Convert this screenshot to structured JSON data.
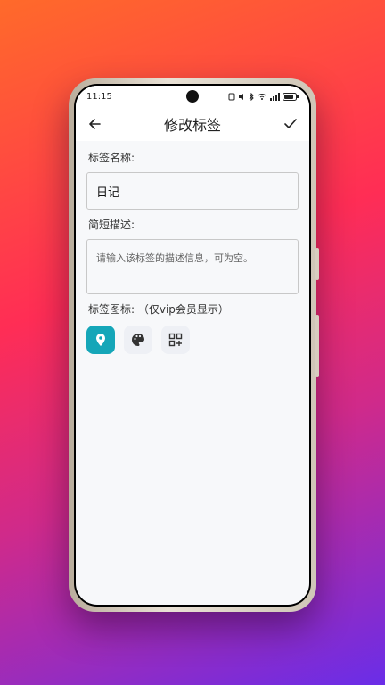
{
  "status": {
    "time": "11:15"
  },
  "header": {
    "title": "修改标签"
  },
  "form": {
    "name_label": "标签名称:",
    "name_value": "日记",
    "desc_label": "简短描述:",
    "desc_placeholder": "请输入该标签的描述信息，可为空。",
    "icon_label": "标签图标: （仅vip会员显示）"
  },
  "icons": [
    "location-icon",
    "palette-icon",
    "qr-add-icon"
  ],
  "colors": {
    "accent": "#15a6b8",
    "background": "#f7f8fa"
  }
}
